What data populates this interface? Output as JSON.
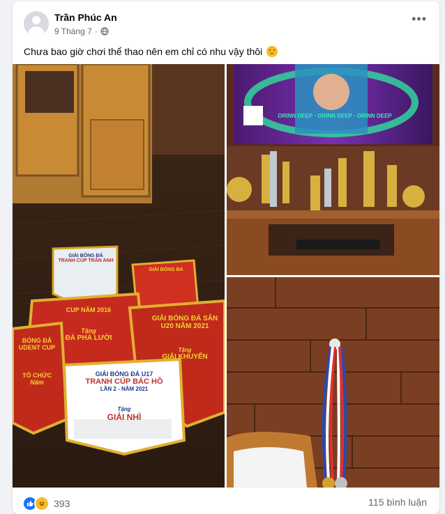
{
  "post": {
    "author": "Trần Phúc An",
    "date": "9 Tháng 7",
    "separator": "·",
    "privacy_icon": "globe-icon",
    "more_icon": "more-options-icon",
    "text": "Chưa bao giờ chơi thể thao nên em chỉ có nhu vậy thôi",
    "text_emoji": "confounded-face-emoji"
  },
  "photos": {
    "left": {
      "banners": [
        {
          "line1": "GIẢI BÓNG ĐÁ",
          "line2": "TRANH CÚP TRẦN ANH"
        },
        {
          "line1": "GIẢI BÓNG ĐÁ",
          "line2": ""
        },
        {
          "line1": "CUP",
          "line2": "NĂM 2016",
          "line3": "Tặng",
          "line4": "ĐÀ PHÁ LƯỚI"
        },
        {
          "line1": "GIẢI BÓNG ĐÁ SÂN",
          "line2": "U20 NĂM 2021",
          "line3": "Tặng",
          "line4": "GIẢI KHUYẾN"
        },
        {
          "line1": "BÓNG ĐÁ",
          "line2": "UDENT CUP",
          "line3": "TỔ CHỨC",
          "line4": "Năm"
        },
        {
          "line1": "GIẢI BÓNG ĐÁ U17",
          "line2": "TRANH CÚP BÁC HỒ",
          "line3": "LẦN 2 - NĂM 2021",
          "line4": "Tặng",
          "line5": "GIẢI NHÌ"
        }
      ]
    },
    "top_right": {
      "tv_text": "ORINN DEEP · ORINN DEEP · ORINN DEEP"
    },
    "bottom_right": {}
  },
  "reactions": {
    "icons": [
      "like-icon",
      "haha-icon"
    ],
    "count": "393",
    "comments": "115 bình luận"
  },
  "colors": {
    "like": "#1877f2",
    "haha": "#f7b928",
    "text_primary": "#050505",
    "text_secondary": "#65676b"
  }
}
